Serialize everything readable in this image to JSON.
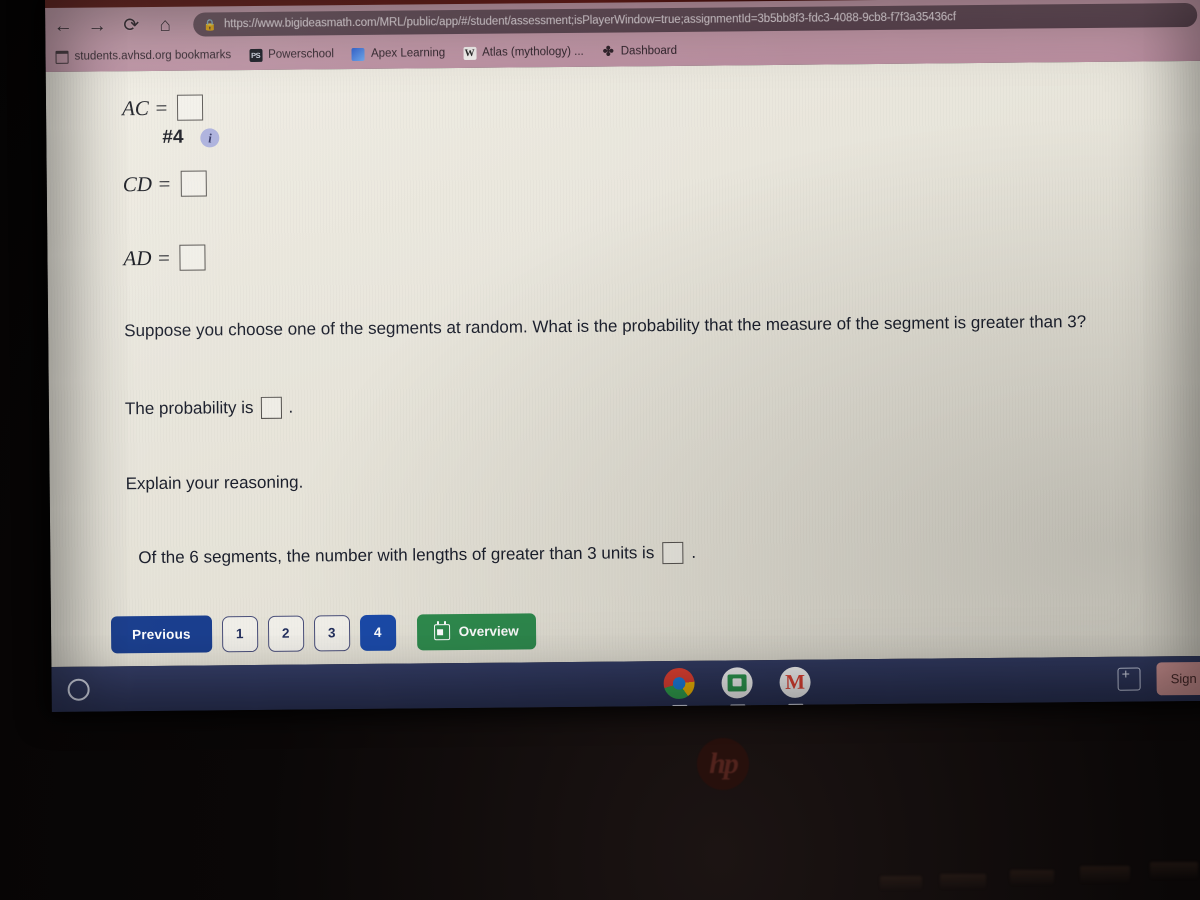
{
  "browser": {
    "back_icon": "←",
    "forward_icon": "→",
    "reload_icon": "⟳",
    "home_icon": "⌂",
    "lock_icon": "🔒",
    "url": "https://www.bigideasmath.com/MRL/public/app/#/student/assessment;isPlayerWindow=true;assignmentId=3b5bb8f3-fdc3-4088-9cb8-f7f3a35436cf",
    "bookmarks": [
      {
        "label": "students.avhsd.org bookmarks",
        "icon": "folder-icon",
        "glyph": ""
      },
      {
        "label": "Powerschool",
        "icon": "powerschool-icon",
        "glyph": "PS"
      },
      {
        "label": "Apex Learning",
        "icon": "apex-learning-icon",
        "glyph": ""
      },
      {
        "label": "Atlas (mythology) ...",
        "icon": "wikipedia-icon",
        "glyph": "W"
      },
      {
        "label": "Dashboard",
        "icon": "dashboard-icon",
        "glyph": "✤"
      }
    ]
  },
  "assessment": {
    "rows": [
      {
        "label": "AC ="
      },
      {
        "label": "CD ="
      },
      {
        "label": "AD ="
      }
    ],
    "problem_number": "#4",
    "info_icon_glyph": "i",
    "question": "Suppose you choose one of the segments at random. What is the probability that the measure of the segment is greater than 3?",
    "probability_label": "The probability is",
    "probability_suffix": ".",
    "explain_label": "Explain your reasoning.",
    "of_six_label": "Of the 6 segments, the number with lengths of greater than 3 units is",
    "of_six_suffix": "."
  },
  "nav": {
    "previous_label": "Previous",
    "pages": [
      "1",
      "2",
      "3",
      "4"
    ],
    "active_page": "4",
    "overview_label": "Overview",
    "overview_icon": "calendar-icon"
  },
  "shelf": {
    "launcher_icon": "launcher-circle-icon",
    "apps": [
      {
        "name": "chrome-icon",
        "label": "Chrome"
      },
      {
        "name": "google-classroom-icon",
        "label": "Google Classroom"
      },
      {
        "name": "gmail-icon",
        "label": "Gmail",
        "glyph": "M"
      }
    ],
    "window_stack_icon": "window-stack-icon",
    "signout_label": "Sign o"
  },
  "hardware": {
    "brand_logo": "hp"
  },
  "colors": {
    "accent_blue": "#1b4aa8",
    "previous_blue": "#1b3f8f",
    "overview_green": "#2f8b4e",
    "page_background": "#e9e6dc",
    "shelf_blue": "#2c3459",
    "signout_red": "#d89a9a",
    "info_lavender": "#a9aedb"
  }
}
